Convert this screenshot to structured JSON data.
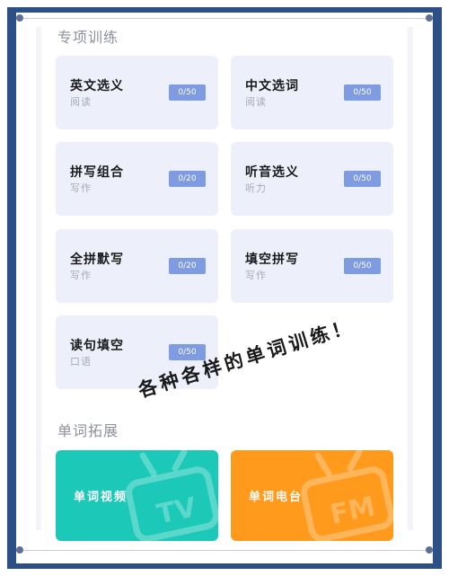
{
  "special_training": {
    "title": "专项训练",
    "cards": [
      {
        "title": "英文选义",
        "sub": "阅读",
        "progress": "0/50"
      },
      {
        "title": "中文选词",
        "sub": "阅读",
        "progress": "0/50"
      },
      {
        "title": "拼写组合",
        "sub": "写作",
        "progress": "0/20"
      },
      {
        "title": "听音选义",
        "sub": "听力",
        "progress": "0/50"
      },
      {
        "title": "全拼默写",
        "sub": "写作",
        "progress": "0/20"
      },
      {
        "title": "填空拼写",
        "sub": "写作",
        "progress": "0/50"
      },
      {
        "title": "读句填空",
        "sub": "口语",
        "progress": "0/50"
      }
    ]
  },
  "promo_text": "各种各样的单词训练！",
  "word_expansion": {
    "title": "单词拓展",
    "items": [
      {
        "label": "单词视频",
        "watermark": "TV",
        "icon": "tv-icon",
        "color": "#1cc9b8"
      },
      {
        "label": "单词电台",
        "watermark": "FM",
        "icon": "radio-icon",
        "color": "#ff9a1c"
      }
    ]
  }
}
